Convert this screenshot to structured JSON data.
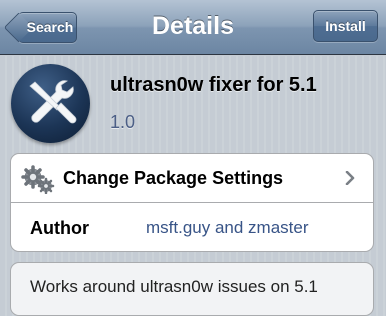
{
  "navbar": {
    "title": "Details",
    "back_label": "Search",
    "install_label": "Install"
  },
  "package": {
    "name": "ultrasn0w fixer for 5.1",
    "version": "1.0",
    "icon": "tools-icon"
  },
  "settings_row": {
    "label": "Change Package Settings",
    "icon": "gears-icon"
  },
  "author_row": {
    "label": "Author",
    "value": "msft.guy and zmaster"
  },
  "description": "Works around ultrasn0w issues on 5.1",
  "colors": {
    "navbar": "#7d95b0",
    "background": "#c5ccd4",
    "version_text": "#4c5f86",
    "author_value": "#385487"
  }
}
